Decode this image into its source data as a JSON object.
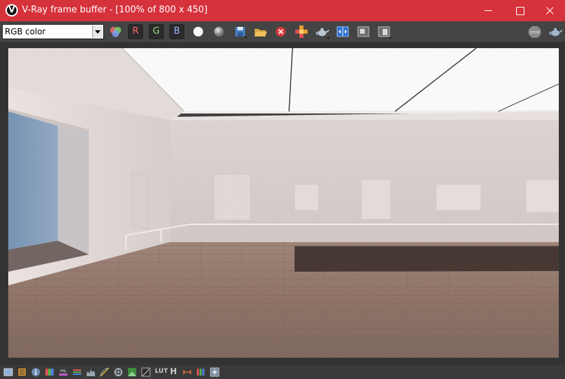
{
  "window": {
    "title": "V-Ray frame buffer - [100% of 800 x 450]"
  },
  "toolbar": {
    "channel_select": {
      "selected": "RGB color"
    },
    "channel_buttons": {
      "r": "R",
      "g": "G",
      "b": "B"
    },
    "icons": [
      "color-channels-icon",
      "white-dot-icon",
      "mono-dot-icon",
      "save-icon",
      "open-folder-icon",
      "clear-image-icon",
      "track-mouse-icon",
      "teapot-region-icon",
      "compare-icon",
      "history-icon",
      "layers-icon",
      "stop-render-icon",
      "teapot-render-icon"
    ]
  },
  "statusbar": {
    "icons": [
      "color-correction-icon",
      "display-options-icon",
      "info-icon",
      "levels-icon",
      "hsl-icon",
      "channels-icon",
      "histogram-icon",
      "curves-icon",
      "exposure-icon",
      "lens-effects-icon",
      "image-icon",
      "curve-icon",
      "lut-icon",
      "hist-icon",
      "stereo-icon",
      "ocio-icon",
      "settings-icon"
    ],
    "lut_label": "LUT",
    "h_label": "H"
  },
  "colors": {
    "titlebar": "#d6323c",
    "toolbar": "#444444",
    "viewport": "#333333",
    "statusbar": "#3a3a3a"
  }
}
